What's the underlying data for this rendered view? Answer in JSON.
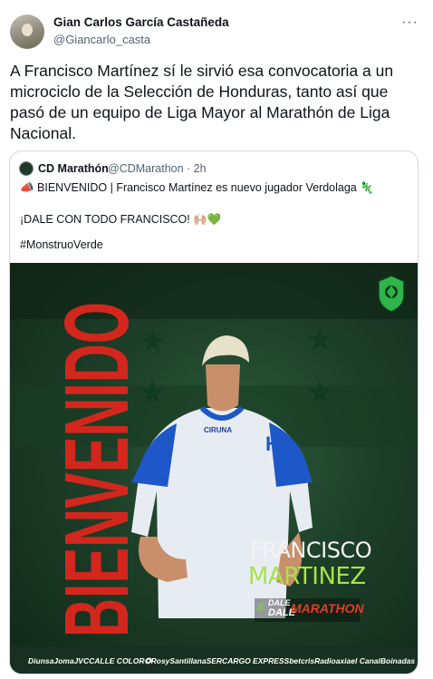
{
  "tweet": {
    "author_name": "Gian Carlos García Castañeda",
    "author_handle": "@Giancarlo_casta",
    "more": "···",
    "text": "A Francisco Martínez sí le sirvió esa convocatoria a un microciclo de la Selección de Honduras, tanto así que pasó de un equipo de Liga Mayor al Marathón de Liga Nacional."
  },
  "quote": {
    "name": "CD Marathón",
    "handle": "@CDMarathon · 2h",
    "line1": "📣 BIENVENIDO | Francisco Martínez es nuevo jugador Verdolaga 🦎",
    "line2": "¡DALE CON TODO FRANCISCO! 🙌🏼💚",
    "line3": "#MonstruoVerde"
  },
  "image": {
    "banner": "BIENVENIDO",
    "first_name": "FRANCISCO",
    "last_name": "MARTINEZ",
    "hash": "#",
    "dale1": "DALE",
    "dale2": "DALE",
    "club": "MARATHON",
    "jersey_brand": "CIRUNA",
    "sponsors": [
      "Diunsa",
      "Joma",
      "JVC",
      "CALLE COLOR",
      "✪",
      "Rosy",
      "Santillana",
      "SERCARGO EXPRESS",
      "betcris",
      "Radioaxia",
      "el Canal",
      "Boinadas Express"
    ]
  },
  "colors": {
    "accent_green": "#a8e24c",
    "banner_red": "#d3261d",
    "bg_green": "#1d3f28"
  }
}
